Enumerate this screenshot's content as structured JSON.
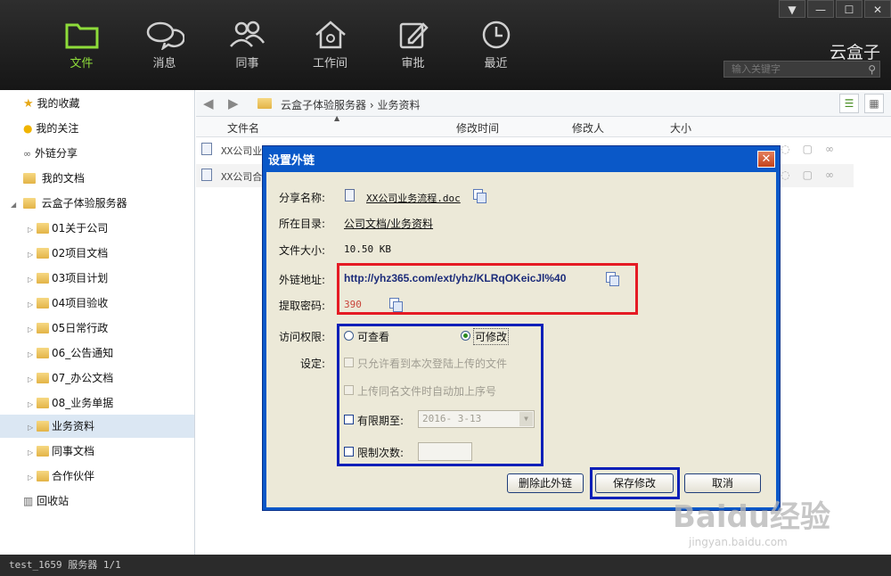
{
  "window_controls": [
    "▼",
    "—",
    "☐",
    "✕"
  ],
  "nav": [
    {
      "label": "文件",
      "icon": "folder-icon",
      "active": true
    },
    {
      "label": "消息",
      "icon": "chat-icon",
      "active": false
    },
    {
      "label": "同事",
      "icon": "people-icon",
      "active": false
    },
    {
      "label": "工作间",
      "icon": "house-icon",
      "active": false
    },
    {
      "label": "审批",
      "icon": "edit-icon",
      "active": false
    },
    {
      "label": "最近",
      "icon": "clock-icon",
      "active": false
    }
  ],
  "brand": "云盒子",
  "search": {
    "placeholder": "输入关键字"
  },
  "sidebar": {
    "items": [
      {
        "label": "我的收藏",
        "icon": "star-icon"
      },
      {
        "label": "我的关注",
        "icon": "bulb-icon"
      },
      {
        "label": "外链分享",
        "icon": "link-icon"
      },
      {
        "label": "我的文档",
        "icon": "user-folder-icon"
      },
      {
        "label": "云盒子体验服务器",
        "icon": "server-icon"
      },
      {
        "label": "01关于公司",
        "icon": "folder-icon"
      },
      {
        "label": "02项目文档",
        "icon": "folder-icon"
      },
      {
        "label": "03项目计划",
        "icon": "folder-icon"
      },
      {
        "label": "04项目验收",
        "icon": "folder-icon"
      },
      {
        "label": "05日常行政",
        "icon": "folder-icon"
      },
      {
        "label": "06_公告通知",
        "icon": "folder-icon"
      },
      {
        "label": "07_办公文档",
        "icon": "folder-icon"
      },
      {
        "label": "08_业务单据",
        "icon": "folder-icon"
      },
      {
        "label": "业务资料",
        "icon": "folder-icon"
      },
      {
        "label": "同事文档",
        "icon": "folder-icon"
      },
      {
        "label": "合作伙伴",
        "icon": "folder-icon"
      },
      {
        "label": "回收站",
        "icon": "trash-icon"
      }
    ]
  },
  "toolbar": {
    "back": "◀",
    "forward": "▶",
    "breadcrumb_root": "云盒子体验服务器",
    "breadcrumb_sep": "›",
    "breadcrumb_current": "业务资料"
  },
  "table": {
    "columns": [
      "文件名",
      "修改时间",
      "修改人",
      "大小"
    ],
    "rows": [
      {
        "name": "XX公司业务流程"
      },
      {
        "name": "XX公司合"
      }
    ]
  },
  "dialog": {
    "title": "设置外链",
    "share_name_label": "分享名称:",
    "share_name": "XX公司业务流程.doc",
    "dir_label": "所在目录:",
    "dir": "公司文档/业务资料",
    "size_label": "文件大小:",
    "size": "10.50 KB",
    "link_label": "外链地址:",
    "link": "http://yhz365.com/ext/yhz/KLRqOKeicJl%40",
    "pwd_label": "提取密码:",
    "pwd": "390",
    "access_label": "访问权限:",
    "radio_view": "可查看",
    "radio_edit": "可修改",
    "settings_label": "设定:",
    "opt_only_own": "只允许看到本次登陆上传的文件",
    "opt_auto_seq": "上传同名文件时自动加上序号",
    "opt_expire": "有限期至:",
    "expire_date": "2016- 3-13",
    "opt_limit": "限制次数:",
    "btn_delete": "删除此外链",
    "btn_save": "保存修改",
    "btn_cancel": "取消"
  },
  "statusbar": {
    "text": "test_1659  服务器 1/1"
  },
  "watermark": {
    "main": "Baidu经验",
    "sub": "jingyan.baidu.com"
  }
}
